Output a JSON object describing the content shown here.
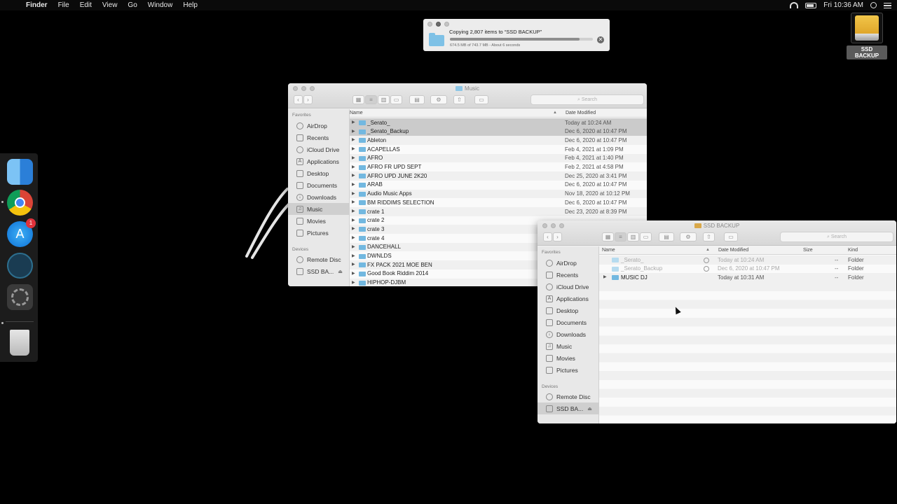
{
  "menubar": {
    "apple_icon": "",
    "app_name": "Finder",
    "menus": [
      "File",
      "Edit",
      "View",
      "Go",
      "Window",
      "Help"
    ],
    "clock": "Fri 10:36 AM",
    "status_icons": [
      "wifi-icon",
      "battery-icon",
      "spotlight-icon",
      "notification-center-icon"
    ]
  },
  "drive": {
    "label": "SSD BACKUP",
    "color": "#f2c64a"
  },
  "copy_dialog": {
    "title": "Copying 2,807 items to “SSD BACKUP”",
    "status": "674.5 MB of 743.7 MB - About 6 seconds",
    "progress_percent": 90.7,
    "cancel_symbol": "✕"
  },
  "dock": {
    "apps": [
      "Finder",
      "Google Chrome",
      "App Store",
      "Serato",
      "System Preferences",
      "Trash"
    ],
    "app_store_badge": "1"
  },
  "music_window": {
    "title": "Music",
    "search_placeholder": "Search",
    "sidebar": {
      "favorites_header": "Favorites",
      "favorites": [
        "AirDrop",
        "Recents",
        "iCloud Drive",
        "Applications",
        "Desktop",
        "Documents",
        "Downloads",
        "Music",
        "Movies",
        "Pictures"
      ],
      "active": "Music",
      "devices_header": "Devices",
      "devices": [
        "Remote Disc",
        "SSD BA..."
      ]
    },
    "columns": {
      "name": "Name",
      "date": "Date Modified"
    },
    "rows": [
      {
        "name": "_Serato_",
        "date": "Today at 10:24 AM",
        "selected": true
      },
      {
        "name": "_Serato_Backup",
        "date": "Dec 6, 2020 at 10:47 PM",
        "selected": true
      },
      {
        "name": "Ableton",
        "date": "Dec 6, 2020 at 10:47 PM"
      },
      {
        "name": "ACAPELLAS",
        "date": "Feb 4, 2021 at 1:09 PM"
      },
      {
        "name": "AFRO",
        "date": "Feb 4, 2021 at 1:40 PM"
      },
      {
        "name": "AFRO FR UPD SEPT",
        "date": "Feb 2, 2021 at 4:58 PM"
      },
      {
        "name": "AFRO UPD JUNE 2K20",
        "date": "Dec 25, 2020 at 3:41 PM"
      },
      {
        "name": "ARAB",
        "date": "Dec 6, 2020 at 10:47 PM"
      },
      {
        "name": "Audio Music Apps",
        "date": "Nov 18, 2020 at 10:12 PM"
      },
      {
        "name": "BM RIDDIMS SELECTION",
        "date": "Dec 6, 2020 at 10:47 PM"
      },
      {
        "name": "crate 1",
        "date": "Dec 23, 2020 at 8:39 PM"
      },
      {
        "name": "crate 2",
        "date": ""
      },
      {
        "name": "crate 3",
        "date": ""
      },
      {
        "name": "crate 4",
        "date": ""
      },
      {
        "name": "DANCEHALL",
        "date": ""
      },
      {
        "name": "DWNLDS",
        "date": ""
      },
      {
        "name": "FX PACK 2021 MOE BEN",
        "date": ""
      },
      {
        "name": "Good Book Riddim 2014",
        "date": ""
      },
      {
        "name": "HIPHOP-DJBM",
        "date": ""
      }
    ]
  },
  "ssd_window": {
    "title": "SSD BACKUP",
    "search_placeholder": "Search",
    "sidebar": {
      "favorites_header": "Favorites",
      "favorites": [
        "AirDrop",
        "Recents",
        "iCloud Drive",
        "Applications",
        "Desktop",
        "Documents",
        "Downloads",
        "Music",
        "Movies",
        "Pictures"
      ],
      "devices_header": "Devices",
      "devices": [
        "Remote Disc",
        "SSD BA..."
      ],
      "active": "SSD BA..."
    },
    "columns": {
      "name": "Name",
      "date": "Date Modified",
      "size": "Size",
      "kind": "Kind"
    },
    "rows": [
      {
        "name": "_Serato_",
        "date": "Today at 10:24 AM",
        "size": "--",
        "kind": "Folder",
        "copying": true
      },
      {
        "name": "_Serato_Backup",
        "date": "Dec 6, 2020 at 10:47 PM",
        "size": "--",
        "kind": "Folder",
        "copying": true
      },
      {
        "name": "MUSIC DJ",
        "date": "Today at 10:31 AM",
        "size": "--",
        "kind": "Folder",
        "copying": false
      }
    ]
  }
}
